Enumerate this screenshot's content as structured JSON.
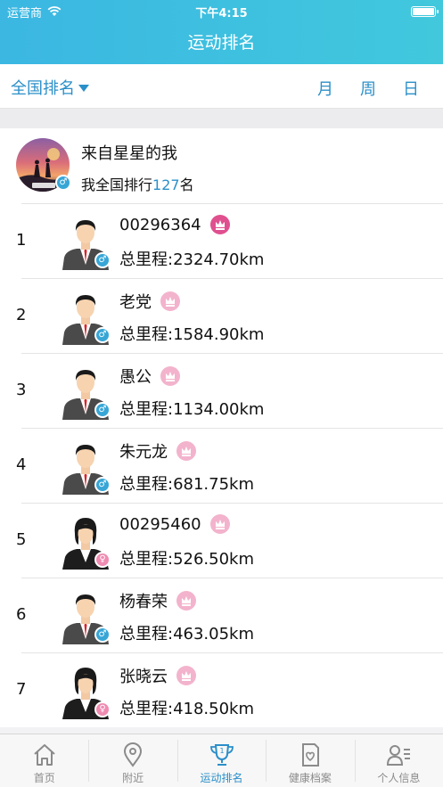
{
  "status": {
    "carrier": "运营商",
    "time": "下午4:15"
  },
  "title": "运动排名",
  "filter": {
    "scope": "全国排名",
    "periods": [
      "月",
      "周",
      "日"
    ]
  },
  "me": {
    "name": "来自星星的我",
    "rank_prefix": "我全国排行",
    "rank_number": "127",
    "rank_suffix": "名",
    "gender": "male"
  },
  "rankings": [
    {
      "rank": "1",
      "name": "00296364",
      "distance": "总里程:2324.70km",
      "gender": "male",
      "medal_color": "#e0508f"
    },
    {
      "rank": "2",
      "name": "老党",
      "distance": "总里程:1584.90km",
      "gender": "male",
      "medal_color": "#f3b3cc"
    },
    {
      "rank": "3",
      "name": "愚公",
      "distance": "总里程:1134.00km",
      "gender": "male",
      "medal_color": "#f3b3cc"
    },
    {
      "rank": "4",
      "name": "朱元龙",
      "distance": "总里程:681.75km",
      "gender": "male",
      "medal_color": "#f3b3cc"
    },
    {
      "rank": "5",
      "name": "00295460",
      "distance": "总里程:526.50km",
      "gender": "female",
      "medal_color": "#f3b3cc"
    },
    {
      "rank": "6",
      "name": "杨春荣",
      "distance": "总里程:463.05km",
      "gender": "male",
      "medal_color": "#f3b3cc"
    },
    {
      "rank": "7",
      "name": "张晓云",
      "distance": "总里程:418.50km",
      "gender": "female",
      "medal_color": "#f3b3cc"
    }
  ],
  "tabs": [
    {
      "label": "首页",
      "icon": "home-icon",
      "active": false
    },
    {
      "label": "附近",
      "icon": "location-pin-icon",
      "active": false
    },
    {
      "label": "运动排名",
      "icon": "trophy-icon",
      "active": true
    },
    {
      "label": "健康档案",
      "icon": "health-record-icon",
      "active": false
    },
    {
      "label": "个人信息",
      "icon": "profile-icon",
      "active": false
    }
  ],
  "colors": {
    "accent": "#2b8fc9",
    "header": "#3bb7e2",
    "male": "#37a6d6",
    "female": "#f08bb1"
  }
}
